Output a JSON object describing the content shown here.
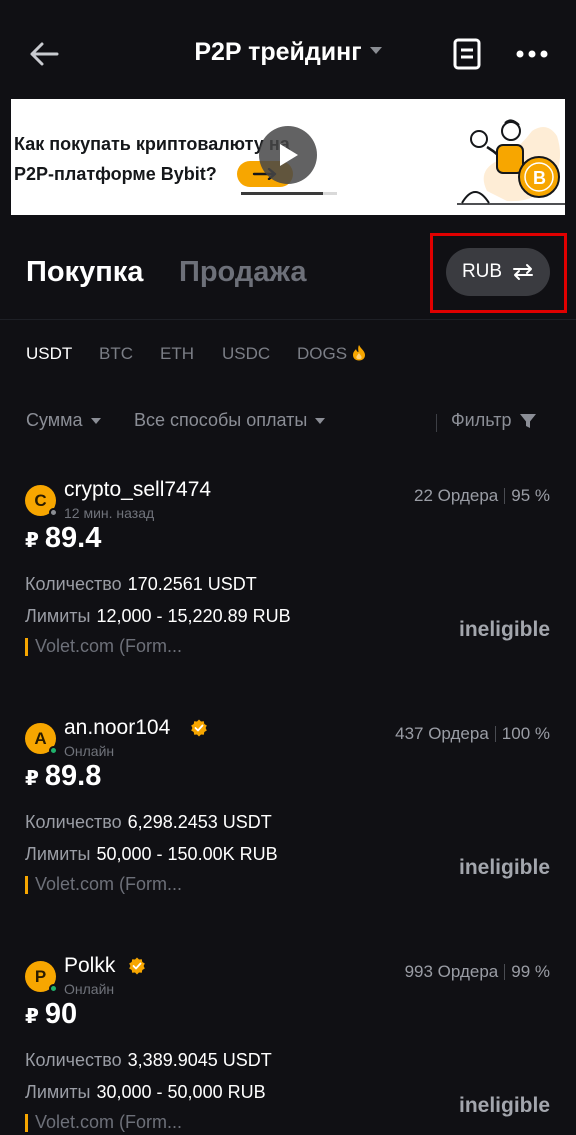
{
  "header": {
    "title": "P2P трейдинг"
  },
  "banner": {
    "line1": "Как покупать криптовалюту на",
    "line2": "P2P-платформе Bybit?",
    "video_progress": 0.85
  },
  "trade_tabs": {
    "buy_label": "Покупка",
    "sell_label": "Продажа",
    "fiat_currency": "RUB"
  },
  "coins": [
    {
      "label": "USDT",
      "active": true
    },
    {
      "label": "BTC",
      "active": false
    },
    {
      "label": "ETH",
      "active": false
    },
    {
      "label": "USDC",
      "active": false
    },
    {
      "label": "DOGS",
      "active": false
    }
  ],
  "filters": {
    "amount_label": "Сумма",
    "payment_label": "Все способы оплаты",
    "filter_label": "Фильтр"
  },
  "labels": {
    "quantity": "Количество",
    "limits": "Лимиты",
    "ineligible": "ineligible"
  },
  "offers": [
    {
      "avatar_letter": "C",
      "name": "crypto_sell7474",
      "verified": false,
      "status": "12 мин. назад",
      "online": false,
      "orders": "22 Ордера",
      "completion": "95 %",
      "currency_symbol": "₽",
      "price": "89.4",
      "quantity": "170.2561 USDT",
      "limits": "12,000 - 15,220.89 RUB",
      "payment": "Volet.com (Form..."
    },
    {
      "avatar_letter": "A",
      "name": "an.noor104",
      "verified": true,
      "status": "Онлайн",
      "online": true,
      "orders": "437 Ордера",
      "completion": "100 %",
      "currency_symbol": "₽",
      "price": "89.8",
      "quantity": "6,298.2453 USDT",
      "limits": "50,000 - 150.00K RUB",
      "payment": "Volet.com (Form..."
    },
    {
      "avatar_letter": "P",
      "name": "Polkk",
      "verified": true,
      "status": "Онлайн",
      "online": true,
      "orders": "993 Ордера",
      "completion": "99 %",
      "currency_symbol": "₽",
      "price": "90",
      "quantity": "3,389.9045 USDT",
      "limits": "30,000 - 50,000 RUB",
      "payment": "Volet.com (Form..."
    }
  ],
  "colors": {
    "background": "#101014",
    "accent": "#f7a600",
    "online": "#20b26c",
    "offline": "#8a8d93",
    "highlight_box": "#e00000"
  },
  "icons": {
    "back": "back-arrow-icon",
    "orders": "orders-list-icon",
    "more": "more-dots-icon",
    "play": "play-icon",
    "swap": "swap-arrows-icon",
    "fire": "fire-icon",
    "verified": "verified-badge-icon",
    "filter": "funnel-icon"
  }
}
